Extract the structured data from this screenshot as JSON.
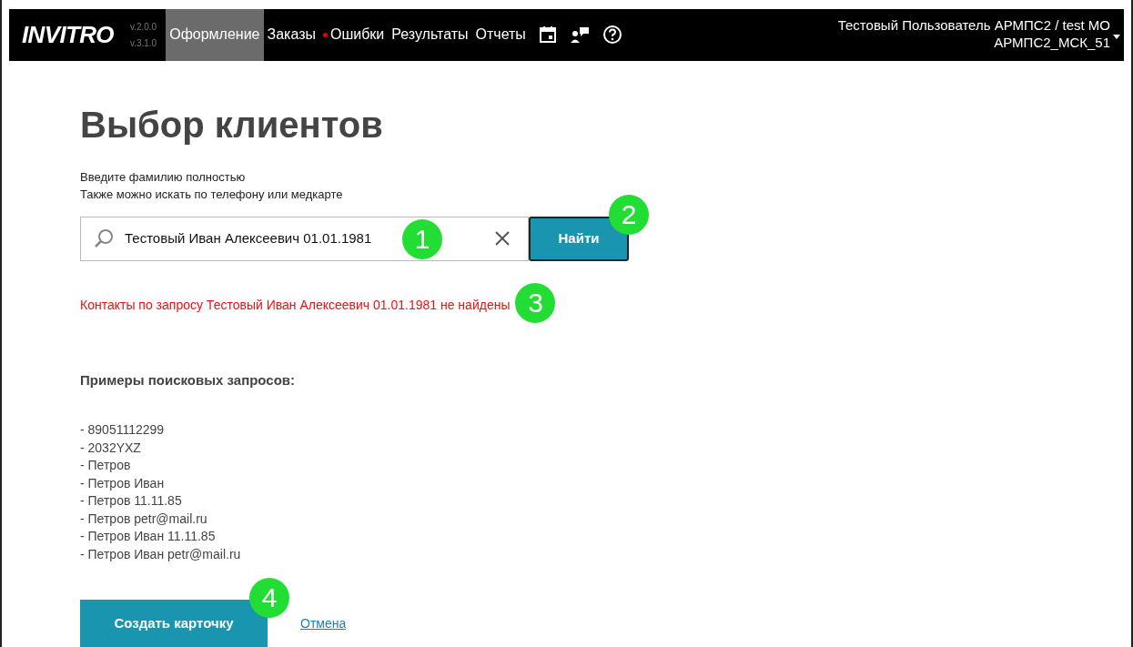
{
  "header": {
    "logo": "INVITRO",
    "versions": [
      "v.2.0.0",
      "v.3.1.0"
    ],
    "nav": [
      {
        "label": "Оформление",
        "selected": true,
        "alert": false
      },
      {
        "label": "Заказы",
        "selected": false,
        "alert": false
      },
      {
        "label": "Ошибки",
        "selected": false,
        "alert": true
      },
      {
        "label": "Результаты",
        "selected": false,
        "alert": false
      },
      {
        "label": "Отчеты",
        "selected": false,
        "alert": false
      }
    ],
    "user": [
      "Тестовый Пользователь АРМПС2 / test МО",
      "АРМПС2_МСК_51"
    ]
  },
  "title": "Выбор клиентов",
  "hints": [
    "Введите фамилию полностью",
    "Также можно искать по телефону или медкарте"
  ],
  "search": {
    "value": "Тестовый Иван Алексеевич 01.01.1981",
    "marker": "1"
  },
  "find_button": {
    "label": "Найти",
    "marker": "2"
  },
  "error": {
    "text": "Контакты по запросу Тестовый Иван Алексеевич 01.01.1981 не найдены",
    "marker": "3"
  },
  "examples": {
    "heading": "Примеры поисковых запросов:",
    "items": [
      "- 89051112299",
      "- 2032YXZ",
      "- Петров",
      "- Петров Иван",
      "- Петров 11.11.85",
      "- Петров petr@mail.ru",
      "- Петров Иван 11.11.85",
      "- Петров Иван petr@mail.ru"
    ]
  },
  "create_button": {
    "label": "Создать карточку",
    "marker": "4"
  },
  "cancel_link": "Отмена"
}
